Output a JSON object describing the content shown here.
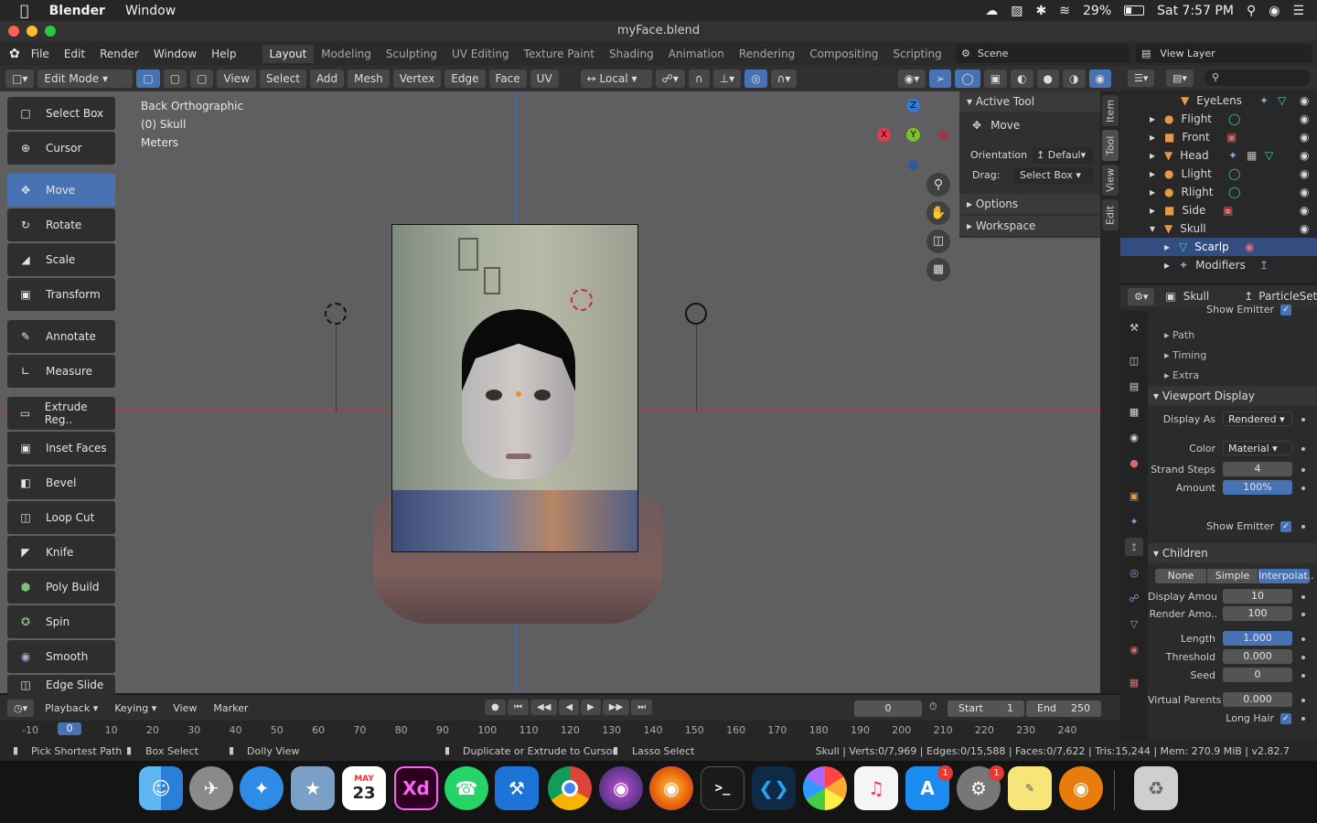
{
  "macbar": {
    "app": "Blender",
    "menu": "Window",
    "battery": "29%",
    "clock": "Sat 7:57 PM"
  },
  "window": {
    "title": "myFace.blend"
  },
  "topbar": {
    "menus": [
      "File",
      "Edit",
      "Render",
      "Window",
      "Help"
    ],
    "workspaces": [
      "Layout",
      "Modeling",
      "Sculpting",
      "UV Editing",
      "Texture Paint",
      "Shading",
      "Animation",
      "Rendering",
      "Compositing",
      "Scripting"
    ],
    "active_workspace": "Layout",
    "scene": "Scene",
    "view_layer": "View Layer"
  },
  "header": {
    "mode": "Edit Mode",
    "menus": [
      "View",
      "Select",
      "Add",
      "Mesh",
      "Vertex",
      "Edge",
      "Face",
      "UV"
    ],
    "transform": "Local"
  },
  "viewport": {
    "view_name": "Back Orthographic",
    "object": "(0) Skull",
    "units": "Meters",
    "gizmo": {
      "z": "Z",
      "y": "Y",
      "x": "X"
    }
  },
  "tools": [
    "Select Box",
    "Cursor",
    "Move",
    "Rotate",
    "Scale",
    "Transform",
    "Annotate",
    "Measure",
    "Extrude Reg..",
    "Inset Faces",
    "Bevel",
    "Loop Cut",
    "Knife",
    "Poly Build",
    "Spin",
    "Smooth",
    "Edge Slide"
  ],
  "active_tool_index": 2,
  "npanel": {
    "header": "Active Tool",
    "tool": "Move",
    "orientation_label": "Orientation",
    "orientation": "Defaul",
    "drag_label": "Drag:",
    "drag": "Select Box",
    "options": "Options",
    "workspace": "Workspace",
    "tabs": [
      "Item",
      "Tool",
      "View",
      "Edit"
    ]
  },
  "outliner": {
    "rows": [
      {
        "name": "EyeLens",
        "icon": "mesh"
      },
      {
        "name": "Flight",
        "icon": "light"
      },
      {
        "name": "Front",
        "icon": "camera"
      },
      {
        "name": "Head",
        "icon": "mesh"
      },
      {
        "name": "Llight",
        "icon": "light"
      },
      {
        "name": "Rlight",
        "icon": "light"
      },
      {
        "name": "Side",
        "icon": "camera"
      },
      {
        "name": "Skull",
        "icon": "mesh"
      },
      {
        "name": "Scarlp",
        "icon": "particles"
      },
      {
        "name": "Modifiers",
        "icon": "wrench"
      }
    ]
  },
  "properties": {
    "object": "Skull",
    "particles": "ParticleSett",
    "show_emitter_top": "Show Emitter",
    "path": "Path",
    "timing": "Timing",
    "extra": "Extra",
    "viewport_display": "Viewport Display",
    "display_as_label": "Display As",
    "display_as": "Rendered",
    "color_label": "Color",
    "color": "Material",
    "strand_steps_label": "Strand Steps",
    "strand_steps": "4",
    "amount_label": "Amount",
    "amount": "100%",
    "show_emitter": "Show Emitter",
    "children": "Children",
    "child_modes": [
      "None",
      "Simple",
      "Interpolat.."
    ],
    "display_amount_label": "Display Amou..",
    "display_amount": "10",
    "render_amount_label": "Render Amo..",
    "render_amount": "100",
    "length_label": "Length",
    "length": "1.000",
    "threshold_label": "Threshold",
    "threshold": "0.000",
    "seed_label": "Seed",
    "seed": "0",
    "virtual_parents_label": "Virtual Parents",
    "virtual_parents": "0.000",
    "long_hair": "Long Hair"
  },
  "timeline": {
    "menus": [
      "Playback",
      "Keying",
      "View",
      "Marker"
    ],
    "current": "0",
    "start_label": "Start",
    "start": "1",
    "end_label": "End",
    "end": "250",
    "ticks": [
      "-10",
      "0",
      "10",
      "20",
      "30",
      "40",
      "50",
      "60",
      "70",
      "80",
      "90",
      "100",
      "110",
      "120",
      "130",
      "140",
      "150",
      "160",
      "170",
      "180",
      "190",
      "200",
      "210",
      "220",
      "230",
      "240"
    ]
  },
  "status": {
    "left1": "Pick Shortest Path",
    "left2": "Box Select",
    "left3": "Dolly View",
    "mid1": "Duplicate or Extrude to Cursor",
    "mid2": "Lasso Select",
    "stats": "Skull | Verts:0/7,969 | Edges:0/15,588 | Faces:0/7,622 | Tris:15,244 | Mem: 270.9 MiB | v2.82.7"
  },
  "dock": {
    "calendar_month": "MAY",
    "calendar_day": "23",
    "badge": "1"
  }
}
